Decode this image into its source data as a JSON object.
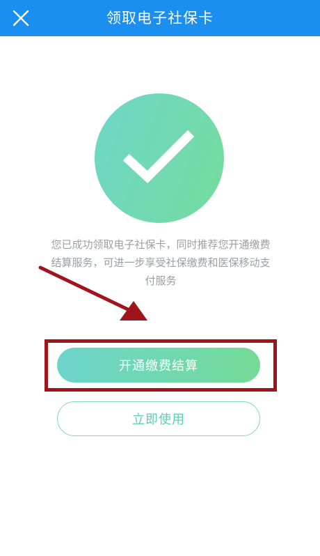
{
  "navbar": {
    "title": "领取电子社保卡",
    "close_icon": "close-icon",
    "background_color": "#1a8ff0"
  },
  "success": {
    "icon": "checkmark-icon",
    "message": "您已成功领取电子社保卡，同时推荐您开通缴费结算服务，可进一步享受社保缴费和医保移动支付服务"
  },
  "actions": {
    "primary_label": "开通缴费结算",
    "secondary_label": "立即使用"
  },
  "annotation": {
    "arrow_icon": "arrow-icon",
    "highlight_color": "#a0141c"
  },
  "colors": {
    "gradient_start": "#6fd6c9",
    "gradient_end": "#74dc9c",
    "text_muted": "#9aa0a6"
  }
}
